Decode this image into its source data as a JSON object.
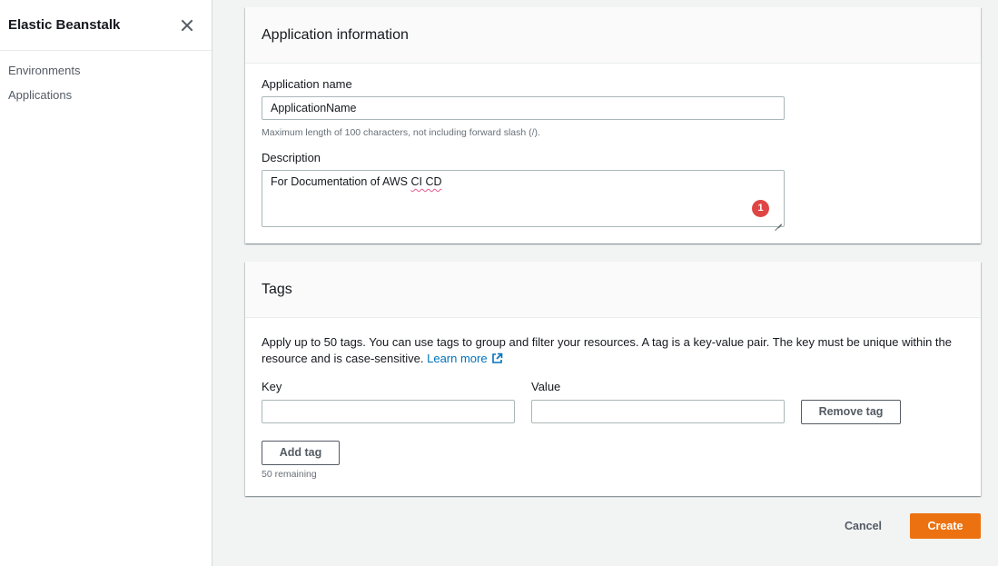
{
  "sidebar": {
    "title": "Elastic Beanstalk",
    "items": [
      {
        "label": "Environments"
      },
      {
        "label": "Applications"
      }
    ]
  },
  "app_info": {
    "title": "Application information",
    "name_label": "Application name",
    "name_value": "ApplicationName",
    "name_constraint": "Maximum length of 100 characters, not including forward slash (/).",
    "description_label": "Description",
    "description_prefix": "For Documentation of AWS ",
    "description_flagged": "CI CD",
    "badge_count": "1"
  },
  "tags": {
    "title": "Tags",
    "description": "Apply up to 50 tags. You can use tags to group and filter your resources. A tag is a key-value pair. The key must be unique within the resource and is case-sensitive.",
    "learn_more": "Learn more",
    "key_label": "Key",
    "value_label": "Value",
    "key_value": "",
    "value_value": "",
    "remove_label": "Remove tag",
    "add_label": "Add tag",
    "remaining": "50 remaining"
  },
  "footer": {
    "cancel_label": "Cancel",
    "create_label": "Create"
  },
  "colors": {
    "primary": "#ec7211",
    "link": "#0073bb",
    "badge": "#e04545"
  },
  "icons": {
    "close": "close-icon",
    "external": "external-link-icon"
  }
}
